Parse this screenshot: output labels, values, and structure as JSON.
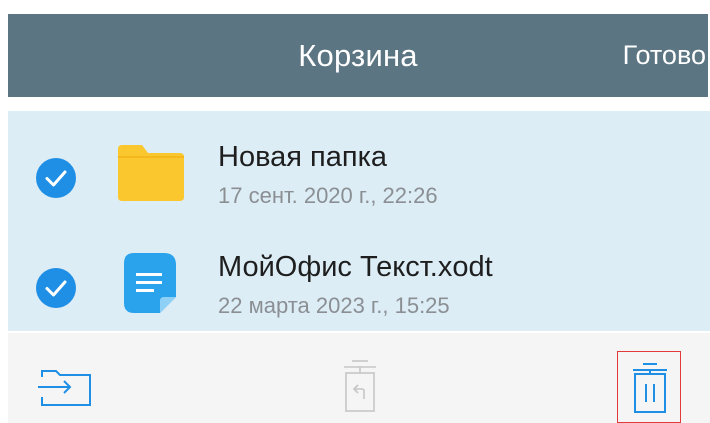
{
  "header": {
    "title": "Корзина",
    "done_label": "Готово"
  },
  "items": [
    {
      "name": "Новая папка",
      "date": "17 сент. 2020 г., 22:26",
      "selected": true,
      "icon": "folder-icon"
    },
    {
      "name": "МойОфис Текст.xodt",
      "date": "22 марта 2023 г., 15:25",
      "selected": true,
      "icon": "text-document-icon"
    }
  ],
  "toolbar": {
    "move_icon": "move-to-folder-icon",
    "restore_icon": "restore-icon",
    "delete_icon": "trash-icon"
  },
  "colors": {
    "header_bg": "#5b7583",
    "selection_bg": "#dcedf6",
    "check_blue": "#1f8fe6",
    "folder_yellow": "#fbc72e",
    "doc_blue": "#2ba3ec",
    "highlight_red": "#e23a3a"
  }
}
